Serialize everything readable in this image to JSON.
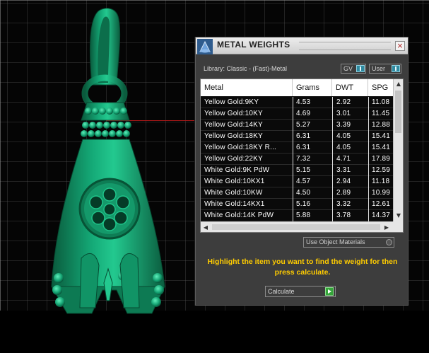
{
  "window": {
    "title": "METAL WEIGHTS",
    "close_glyph": "×"
  },
  "library": {
    "label": "Library: Classic - (Fast)-Metal",
    "toggle_gv": "GV",
    "toggle_user": "User"
  },
  "table": {
    "headers": [
      "Metal",
      "Grams",
      "DWT",
      "SPG"
    ],
    "rows": [
      [
        "Yellow Gold:9KY",
        "4.53",
        "2.92",
        "11.08"
      ],
      [
        "Yellow Gold:10KY",
        "4.69",
        "3.01",
        "11.45"
      ],
      [
        "Yellow Gold:14KY",
        "5.27",
        "3.39",
        "12.88"
      ],
      [
        "Yellow Gold:18KY",
        "6.31",
        "4.05",
        "15.41"
      ],
      [
        "Yellow Gold:18KY R...",
        "6.31",
        "4.05",
        "15.41"
      ],
      [
        "Yellow Gold:22KY",
        "7.32",
        "4.71",
        "17.89"
      ],
      [
        "White Gold:9K PdW",
        "5.15",
        "3.31",
        "12.59"
      ],
      [
        "White Gold:10KX1",
        "4.57",
        "2.94",
        "11.18"
      ],
      [
        "White Gold:10KW",
        "4.50",
        "2.89",
        "10.99"
      ],
      [
        "White Gold:14KX1",
        "5.16",
        "3.32",
        "12.61"
      ],
      [
        "White Gold:14K PdW",
        "5.88",
        "3.78",
        "14.37"
      ]
    ]
  },
  "options": {
    "use_object_materials": "Use Object Materials"
  },
  "instruction": "Highlight the item you want to find the weight for then press calculate.",
  "calculate": {
    "label": "Calculate"
  },
  "icons": {
    "app": "metal-weights-app-icon",
    "close": "close-icon",
    "toggle": "toggle-switch-icon",
    "play": "play-icon",
    "scroll_up": "arrow-up-icon",
    "scroll_down": "arrow-down-icon",
    "scroll_left": "arrow-left-icon",
    "scroll_right": "arrow-right-icon"
  },
  "colors": {
    "accent_yellow": "#ffcc00",
    "model_green": "#12a070",
    "panel_bg": "#3d3d3d"
  }
}
